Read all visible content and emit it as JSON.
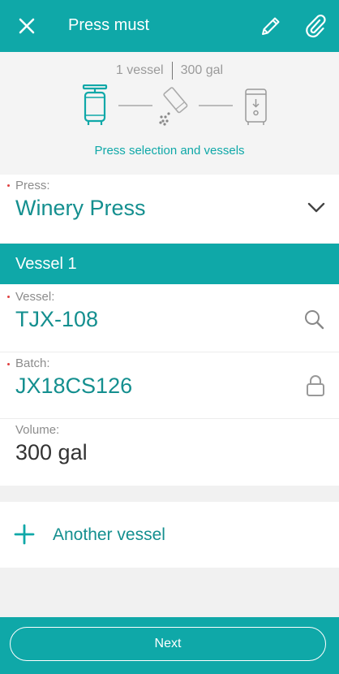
{
  "header": {
    "title": "Press must",
    "icons": [
      "close-icon",
      "pencil-icon",
      "paperclip-icon"
    ],
    "color": "#0fa8a8"
  },
  "summary": {
    "vessel_count": "1 vessel",
    "volume": "300 gal",
    "step_icons": [
      "press-icon",
      "pour-icon",
      "tank-icon"
    ],
    "caption": "Press selection and vessels"
  },
  "press_field": {
    "label": "Press:",
    "value": "Winery Press"
  },
  "section": {
    "title": "Vessel 1"
  },
  "vessel_field": {
    "label": "Vessel:",
    "value": "TJX-108"
  },
  "batch_field": {
    "label": "Batch:",
    "value": "JX18CS126"
  },
  "volume_field": {
    "label": "Volume:",
    "value": "300 gal"
  },
  "add_vessel": {
    "label": "Another vessel"
  },
  "footer": {
    "next_label": "Next"
  },
  "colors": {
    "accent": "#0fa8a8",
    "value_text": "#148f8f",
    "required": "#e04040"
  }
}
